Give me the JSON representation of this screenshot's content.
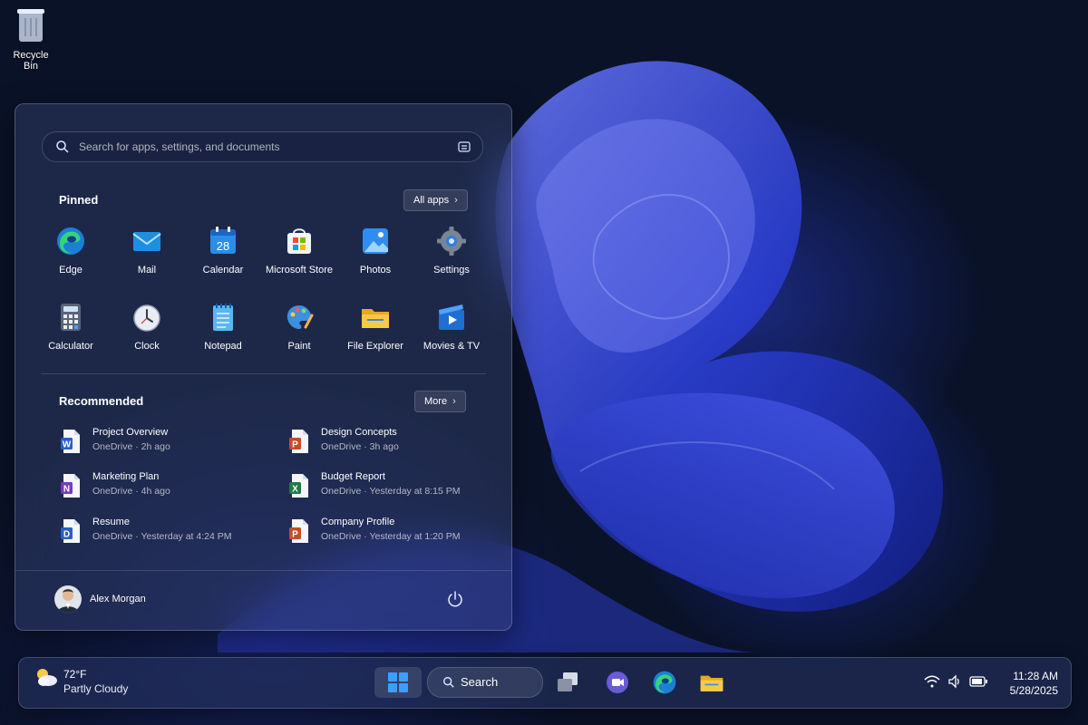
{
  "desktop": {
    "recycle_bin_label": "Recycle Bin"
  },
  "start_menu": {
    "search_placeholder": "Search for apps, settings, and documents",
    "pinned_title": "Pinned",
    "all_apps_label": "All apps",
    "calendar_day": "28",
    "pinned_apps": [
      {
        "label": "Edge",
        "icon": "edge-icon"
      },
      {
        "label": "Mail",
        "icon": "mail-icon"
      },
      {
        "label": "Calendar",
        "icon": "calendar-icon"
      },
      {
        "label": "Microsoft Store",
        "icon": "store-icon"
      },
      {
        "label": "Photos",
        "icon": "photos-icon"
      },
      {
        "label": "Settings",
        "icon": "settings-icon"
      },
      {
        "label": "Calculator",
        "icon": "calculator-icon"
      },
      {
        "label": "Clock",
        "icon": "clock-icon"
      },
      {
        "label": "Notepad",
        "icon": "notepad-icon"
      },
      {
        "label": "Paint",
        "icon": "paint-icon"
      },
      {
        "label": "File Explorer",
        "icon": "folder-icon"
      },
      {
        "label": "Movies & TV",
        "icon": "movies-icon"
      }
    ],
    "recommended_title": "Recommended",
    "more_label": "More",
    "recommended": [
      {
        "name": "Project Overview",
        "meta": "OneDrive · 2h ago",
        "type": "word",
        "letter": "W",
        "color": "#2b5fc7"
      },
      {
        "name": "Design Concepts",
        "meta": "OneDrive · 3h ago",
        "type": "powerpoint",
        "letter": "P",
        "color": "#c74a2b"
      },
      {
        "name": "Marketing Plan",
        "meta": "OneDrive · 4h ago",
        "type": "onenote",
        "letter": "N",
        "color": "#7a3bb8"
      },
      {
        "name": "Budget Report",
        "meta": "OneDrive · Yesterday at 8:15 PM",
        "type": "excel",
        "letter": "X",
        "color": "#1f7a45"
      },
      {
        "name": "Resume",
        "meta": "OneDrive · Yesterday at 4:24 PM",
        "type": "word",
        "letter": "D",
        "color": "#2b5fc7"
      },
      {
        "name": "Company Profile",
        "meta": "OneDrive · Yesterday at 1:20 PM",
        "type": "powerpoint",
        "letter": "P",
        "color": "#c74a2b"
      }
    ],
    "user_name": "Alex Morgan"
  },
  "taskbar": {
    "weather_temp": "72°F",
    "weather_condition": "Partly Cloudy",
    "search_label": "Search",
    "time": "11:28 AM",
    "date": "5/28/2025"
  },
  "colors": {
    "accent": "#3aa0ff",
    "folder": "#f5c542"
  }
}
